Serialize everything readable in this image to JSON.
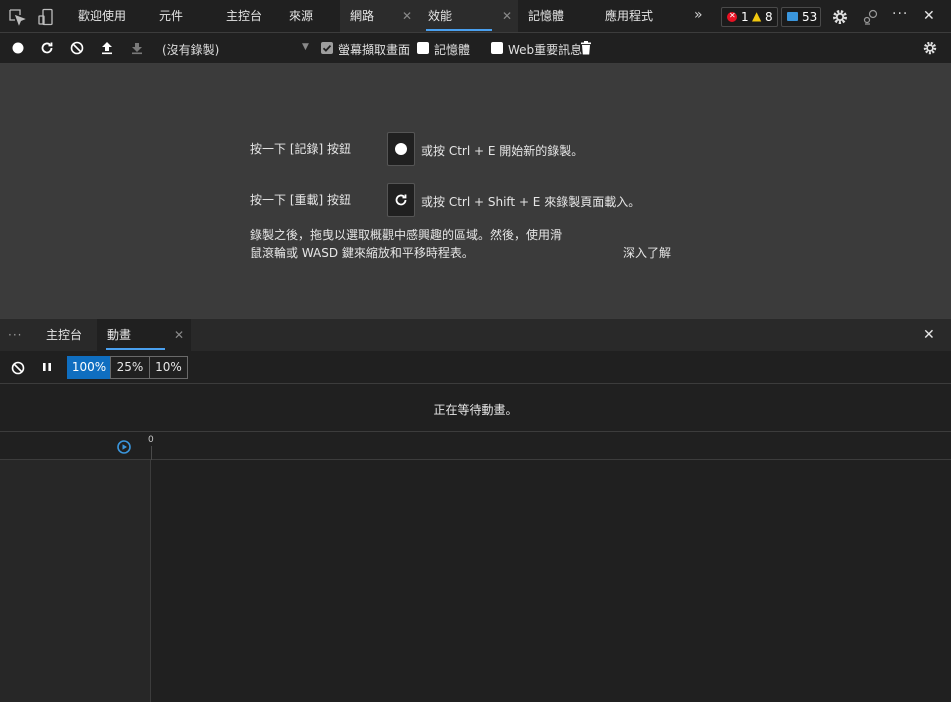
{
  "tabs": [
    {
      "label": "歡迎使用"
    },
    {
      "label": "元件"
    },
    {
      "label": "主控台"
    },
    {
      "label": "來源"
    },
    {
      "label": "網路"
    },
    {
      "label": "效能"
    },
    {
      "label": "記憶體"
    },
    {
      "label": "應用程式"
    }
  ],
  "badges": {
    "errors": "1",
    "warnings": "8",
    "messages": "53"
  },
  "toolbar": {
    "recording_select": "(沒有錄製)",
    "screenshot_label": "螢幕擷取畫面",
    "memory_label": "記憶體",
    "web_vitals_label": "Web重要訊息"
  },
  "perf": {
    "record_line_prefix": "按一下 [記錄] 按鈕",
    "record_line_suffix": "或按 Ctrl + E 開始新的錄製。",
    "reload_line_prefix": "按一下 [重載] 按鈕",
    "reload_line_suffix": "或按 Ctrl + Shift + E 來錄製頁面載入。",
    "after_line1": "錄製之後，拖曳以選取概觀中感興趣的區域。然後，使用滑",
    "after_line2": "鼠滾輪或 WASD 鍵來縮放和平移時程表。",
    "learn_more": "深入了解"
  },
  "drawer": {
    "more_label": "···",
    "tabs": [
      {
        "label": "主控台"
      },
      {
        "label": "動畫"
      }
    ]
  },
  "animation": {
    "speeds": [
      "100%",
      "25%",
      "10%"
    ],
    "waiting": "正在等待動畫。",
    "timeline_zero": "0"
  },
  "colors": {
    "accent": "#4aa0ef",
    "selected": "#0f6ec0",
    "error": "#e81123",
    "warning": "#f2c80f",
    "message": "#3a96dd"
  }
}
